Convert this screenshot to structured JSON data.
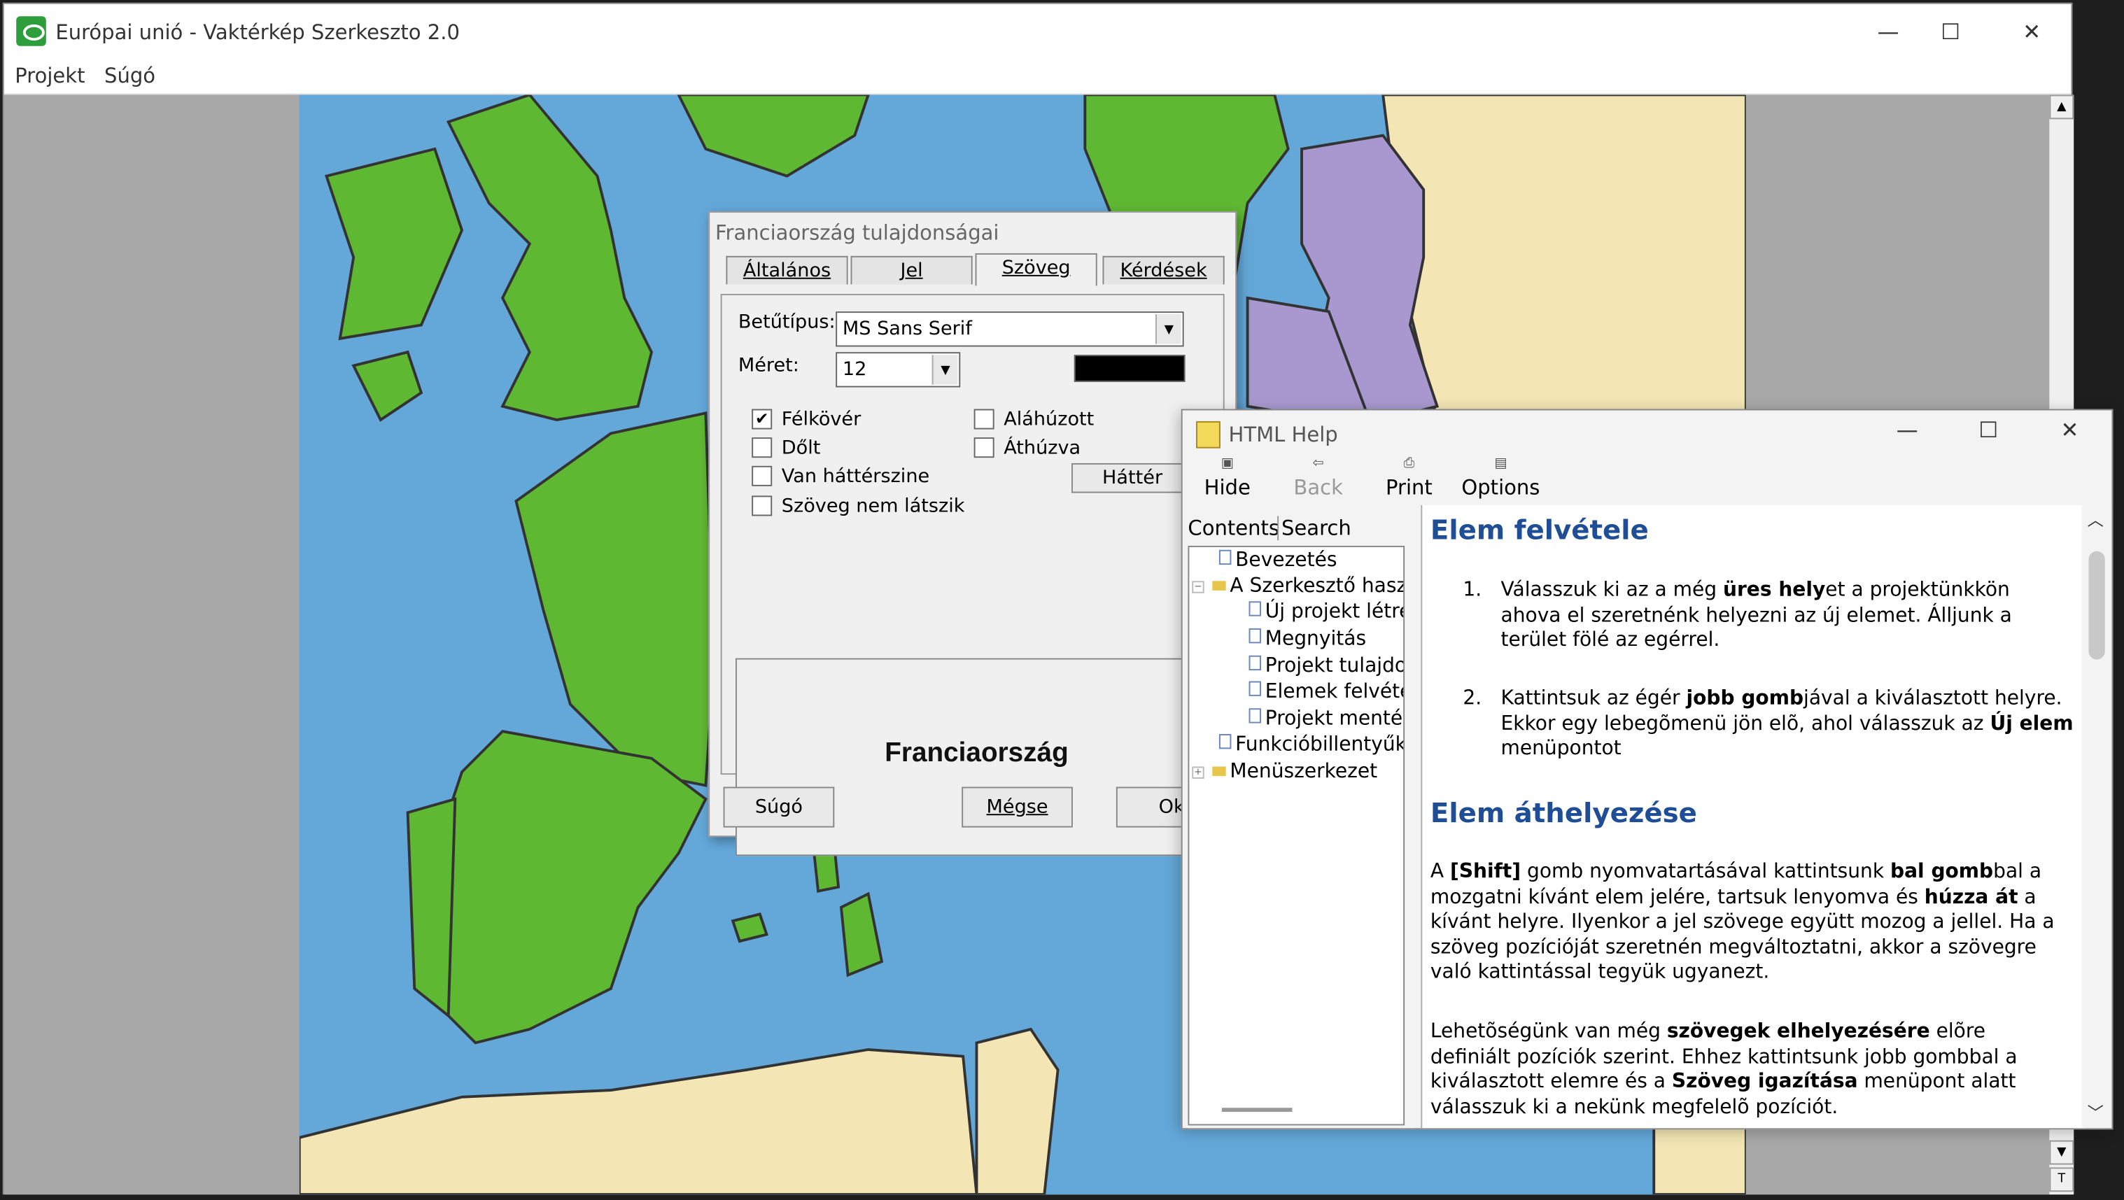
{
  "main_window": {
    "title": "Európai unió - Vaktérkép Szerkeszto 2.0",
    "menu": [
      "Projekt",
      "Súgó"
    ],
    "scroll_up": "▲",
    "scroll_down": "▼",
    "scroll_end": "T"
  },
  "caption_buttons": {
    "minimize": "—",
    "maximize": "☐",
    "close": "✕"
  },
  "dialog": {
    "title": "Franciaország tulajdonságai",
    "tabs": [
      "Általános",
      "Jel",
      "Szöveg",
      "Kérdések"
    ],
    "font_label": "Betűtípus:",
    "font_value": "MS Sans Serif",
    "size_label": "Méret:",
    "size_value": "12",
    "color_swatch": "#000000",
    "checkboxes": [
      {
        "label": "Félkövér",
        "checked": true
      },
      {
        "label": "Dőlt",
        "checked": false
      },
      {
        "label": "Van háttérszine",
        "checked": false
      },
      {
        "label": "Szöveg nem látszik",
        "checked": false
      },
      {
        "label": "Aláhúzott",
        "checked": false
      },
      {
        "label": "Áthúzva",
        "checked": false
      }
    ],
    "background_button": "Háttér",
    "preview_text": "Franciaország",
    "buttons": {
      "help": "Súgó",
      "cancel": "Mégse",
      "ok": "Ok"
    }
  },
  "help_window": {
    "title": "HTML Help",
    "toolbar": [
      {
        "label": "Hide",
        "icon": "hide-icon"
      },
      {
        "label": "Back",
        "icon": "back-arrow-icon"
      },
      {
        "label": "Print",
        "icon": "printer-icon"
      },
      {
        "label": "Options",
        "icon": "options-icon"
      }
    ],
    "nav_tabs": [
      "Contents",
      "Search"
    ],
    "tree": [
      "Bevezetés",
      "A Szerkesztő hasz",
      "Új projekt létreh",
      "Megnyitás",
      "Projekt tulajdor",
      "Elemek felvétel",
      "Projekt mentés",
      "Funkcióbillentyűk",
      "Menüszerkezet"
    ],
    "content": {
      "heading1": "Elem felvétele",
      "step1_num": "1.",
      "step1_parts": [
        "Válasszuk ki az a még ",
        "üres hely",
        "et a projektünkkön ahova el szeretnénk helyezni az új elemet. Álljunk a terület fölé az egérrel."
      ],
      "step2_num": "2.",
      "step2_parts": [
        "Kattintsuk az égér ",
        "jobb gomb",
        "jával a kiválasztott helyre. Ekkor egy lebegõmenü jön elõ, ahol válasszuk az ",
        "Új elem",
        " menüpontot"
      ],
      "heading2": "Elem áthelyezése",
      "para1_parts": [
        "A ",
        "[Shift]",
        " gomb nyomvatartásával kattintsunk ",
        "bal gomb",
        "bal a mozgatni kívánt elem jelére, tartsuk lenyomva és ",
        "húzza át",
        " a kívánt helyre. Ilyenkor a jel szövege együtt mozog a jellel. Ha a szöveg pozícióját szeretnén megváltoztatni, akkor a szövegre való kattintással tegyük ugyanezt."
      ],
      "para2_parts": [
        "Lehetõségünk van még ",
        "szövegek elhelyezésére",
        " elõre definiált pozíciók szerint. Ehhez kattintsunk jobb gombbal a kiválasztott elemre és a ",
        "Szöveg igazítása",
        " menüpont alatt válasszuk ki a nekünk megfelelõ pozíciót."
      ]
    }
  },
  "colors": {
    "sea": "#63a6d8",
    "land_green": "#5fb832",
    "land_beige": "#f3e6b4",
    "land_purple": "#a898cf",
    "heading_blue": "#1f4e96"
  }
}
